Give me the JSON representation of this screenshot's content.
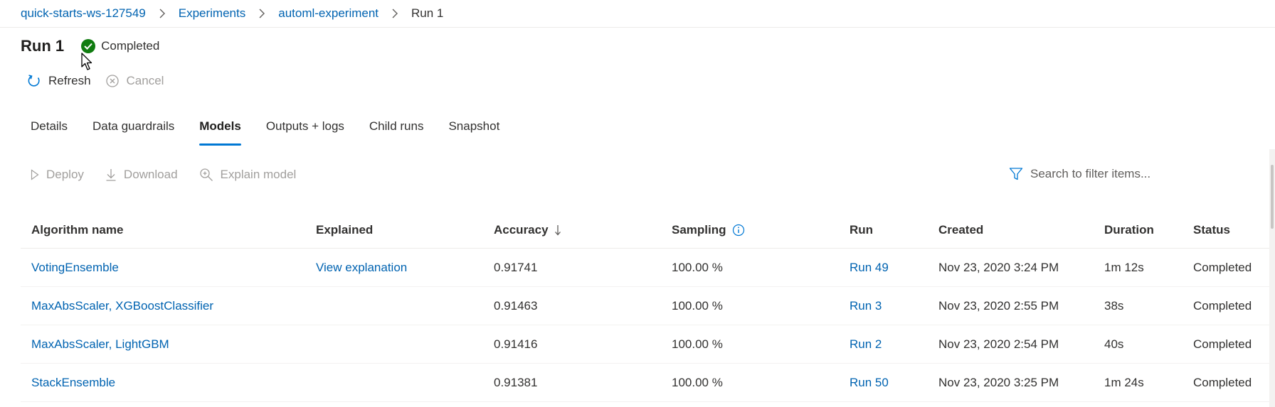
{
  "breadcrumb": {
    "items": [
      "quick-starts-ws-127549",
      "Experiments",
      "automl-experiment"
    ],
    "current": "Run 1"
  },
  "header": {
    "title": "Run 1",
    "status": "Completed"
  },
  "commands": {
    "refresh": "Refresh",
    "cancel": "Cancel"
  },
  "tabs": [
    "Details",
    "Data guardrails",
    "Models",
    "Outputs + logs",
    "Child runs",
    "Snapshot"
  ],
  "active_tab": "Models",
  "toolbar": {
    "deploy": "Deploy",
    "download": "Download",
    "explain": "Explain model",
    "search_placeholder": "Search to filter items..."
  },
  "table": {
    "columns": [
      "Algorithm name",
      "Explained",
      "Accuracy",
      "Sampling",
      "Run",
      "Created",
      "Duration",
      "Status"
    ],
    "rows": [
      [
        "VotingEnsemble",
        "View explanation",
        "0.91741",
        "100.00 %",
        "Run 49",
        "Nov 23, 2020 3:24 PM",
        "1m 12s",
        "Completed"
      ],
      [
        "MaxAbsScaler, XGBoostClassifier",
        "",
        "0.91463",
        "100.00 %",
        "Run 3",
        "Nov 23, 2020 2:55 PM",
        "38s",
        "Completed"
      ],
      [
        "MaxAbsScaler, LightGBM",
        "",
        "0.91416",
        "100.00 %",
        "Run 2",
        "Nov 23, 2020 2:54 PM",
        "40s",
        "Completed"
      ],
      [
        "StackEnsemble",
        "",
        "0.91381",
        "100.00 %",
        "Run 50",
        "Nov 23, 2020 3:25 PM",
        "1m 24s",
        "Completed"
      ]
    ]
  },
  "colors": {
    "link": "#0063b1",
    "accent": "#0078d4",
    "success": "#107c10",
    "disabled": "#a19f9d"
  },
  "icons": [
    "chevron-right-icon",
    "check-circle-icon",
    "refresh-icon",
    "cancel-icon",
    "play-icon",
    "download-icon",
    "search-zoom-icon",
    "filter-icon",
    "sort-down-icon",
    "info-icon",
    "mouse-cursor-icon"
  ]
}
